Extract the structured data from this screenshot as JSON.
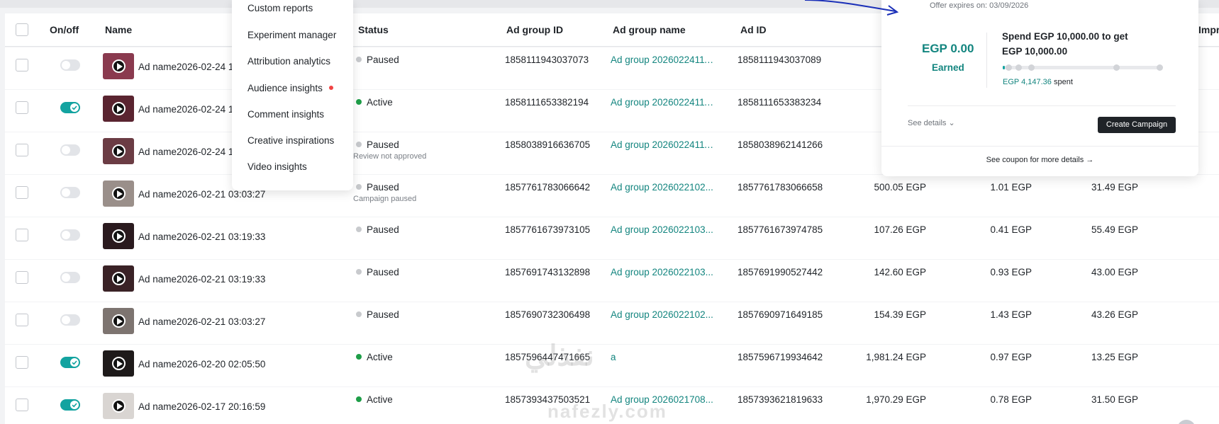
{
  "menu": {
    "items": [
      "Custom reports",
      "Experiment manager",
      "Attribution analytics",
      "Audience insights",
      "Comment insights",
      "Creative inspirations",
      "Video insights"
    ]
  },
  "table": {
    "headers": {
      "onoff": "On/off",
      "name": "Name",
      "status": "Status",
      "ad_group_id": "Ad group ID",
      "ad_group_name": "Ad group name",
      "ad_id": "Ad ID",
      "impr": "Impr"
    },
    "rows": [
      {
        "on": false,
        "name": "Ad name2026-02-24 1",
        "status": "Paused",
        "active": false,
        "sub": "",
        "ad_group_id": "1858111943037073",
        "ad_group_name": "Ad group 20260224111...",
        "ad_id": "1858111943037089",
        "cost": "",
        "cpc": "",
        "cpm": ""
      },
      {
        "on": true,
        "name": "Ad name2026-02-24 1",
        "status": "Active",
        "active": true,
        "sub": "",
        "ad_group_id": "1858111653382194",
        "ad_group_name": "Ad group 20260224111...",
        "ad_id": "1858111653383234",
        "cost": "",
        "cpc": "",
        "cpm": ""
      },
      {
        "on": false,
        "name": "Ad name2026-02-24 1",
        "status": "Paused",
        "active": false,
        "sub": "Review not approved",
        "ad_group_id": "1858038916636705",
        "ad_group_name": "Ad group 20260224111...",
        "ad_id": "1858038962141266",
        "cost": "",
        "cpc": "",
        "cpm": ""
      },
      {
        "on": false,
        "name": "Ad name2026-02-21 03:03:27",
        "status": "Paused",
        "active": false,
        "sub": "Campaign paused",
        "ad_group_id": "1857761783066642",
        "ad_group_name": "Ad group 2026022102...",
        "ad_id": "1857761783066658",
        "cost": "500.05 EGP",
        "cpc": "1.01 EGP",
        "cpm": "31.49 EGP"
      },
      {
        "on": false,
        "name": "Ad name2026-02-21 03:19:33",
        "status": "Paused",
        "active": false,
        "sub": "",
        "ad_group_id": "1857761673973105",
        "ad_group_name": "Ad group 2026022103...",
        "ad_id": "1857761673974785",
        "cost": "107.26 EGP",
        "cpc": "0.41 EGP",
        "cpm": "55.49 EGP"
      },
      {
        "on": false,
        "name": "Ad name2026-02-21 03:19:33",
        "status": "Paused",
        "active": false,
        "sub": "",
        "ad_group_id": "1857691743132898",
        "ad_group_name": "Ad group 2026022103...",
        "ad_id": "1857691990527442",
        "cost": "142.60 EGP",
        "cpc": "0.93 EGP",
        "cpm": "43.00 EGP"
      },
      {
        "on": false,
        "name": "Ad name2026-02-21 03:03:27",
        "status": "Paused",
        "active": false,
        "sub": "",
        "ad_group_id": "1857690732306498",
        "ad_group_name": "Ad group 2026022102...",
        "ad_id": "1857690971649185",
        "cost": "154.39 EGP",
        "cpc": "1.43 EGP",
        "cpm": "43.26 EGP"
      },
      {
        "on": true,
        "name": "Ad name2026-02-20 02:05:50",
        "status": "Active",
        "active": true,
        "sub": "",
        "ad_group_id": "1857596447471665",
        "ad_group_name": "a",
        "ad_id": "1857596719934642",
        "cost": "1,981.24 EGP",
        "cpc": "0.97 EGP",
        "cpm": "13.25 EGP"
      },
      {
        "on": true,
        "name": "Ad name2026-02-17 20:16:59",
        "status": "Active",
        "active": true,
        "sub": "",
        "ad_group_id": "1857393437503521",
        "ad_group_name": "Ad group 2026021708...",
        "ad_id": "1857393621819633",
        "cost": "1,970.29 EGP",
        "cpc": "0.78 EGP",
        "cpm": "31.50 EGP"
      }
    ]
  },
  "coupon": {
    "expires": "Offer expires on: 03/09/2026",
    "earned_value": "EGP 0.00",
    "earned_label": "Earned",
    "spend_line1": "Spend EGP 10,000.00 to get",
    "spend_line2": "EGP 10,000.00",
    "progress_fraction": 0.015,
    "spent_amount": "EGP 4,147.36",
    "spent_label": " spent",
    "see_details": "See details",
    "create_button": "Create Campaign",
    "see_coupon": "See coupon for more details"
  },
  "watermark": {
    "arabic": "نفذلي",
    "latin": "nafezly.com"
  },
  "colors": {
    "accent": "#13a3a0",
    "link": "#13857f",
    "active_dot": "#1e9e48",
    "new_dot": "#f04343",
    "ink": "#1f2328"
  }
}
